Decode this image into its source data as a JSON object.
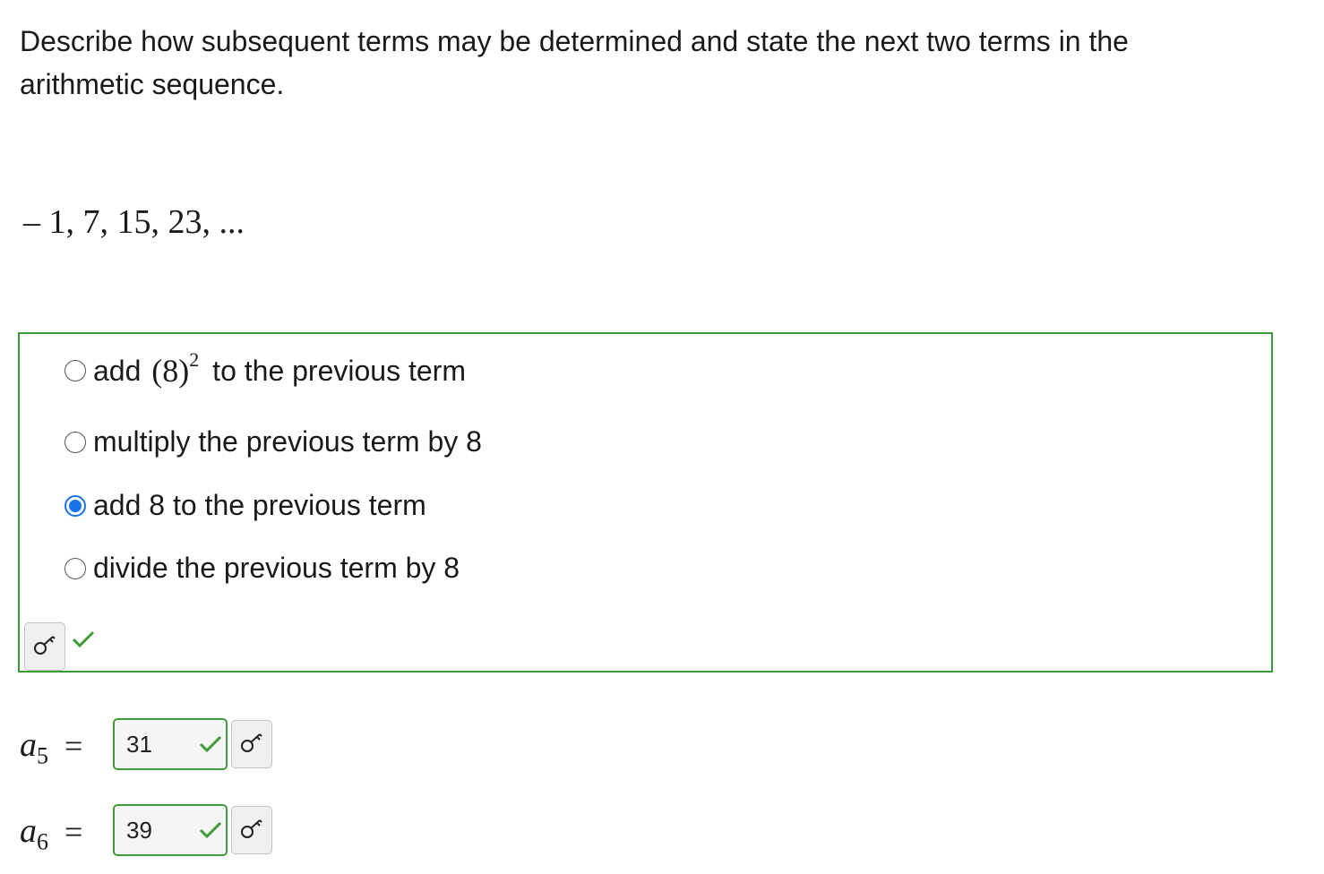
{
  "question": {
    "text": "Describe how subsequent terms may be determined and state the next two terms in the arithmetic sequence."
  },
  "sequence": "– 1, 7, 15, 23, ...",
  "choices": {
    "selected_index": 2,
    "options": [
      {
        "prefix": "add ",
        "math": "(8)",
        "math_sup": "2",
        "suffix": " to the previous term"
      },
      {
        "prefix": "multiply the previous term by 8"
      },
      {
        "prefix": "add 8 to the previous term"
      },
      {
        "prefix": "divide the previous term by 8"
      }
    ],
    "status": "correct"
  },
  "answers": [
    {
      "variable": "a",
      "subscript": "5",
      "equals": "=",
      "value": "31",
      "status": "correct"
    },
    {
      "variable": "a",
      "subscript": "6",
      "equals": "=",
      "value": "39",
      "status": "correct"
    }
  ],
  "icons": {
    "key": "key-icon",
    "check": "check-icon",
    "radio": "radio-icon"
  },
  "colors": {
    "correct_green": "#3f9a3a",
    "radio_selected": "#1a73e8"
  }
}
